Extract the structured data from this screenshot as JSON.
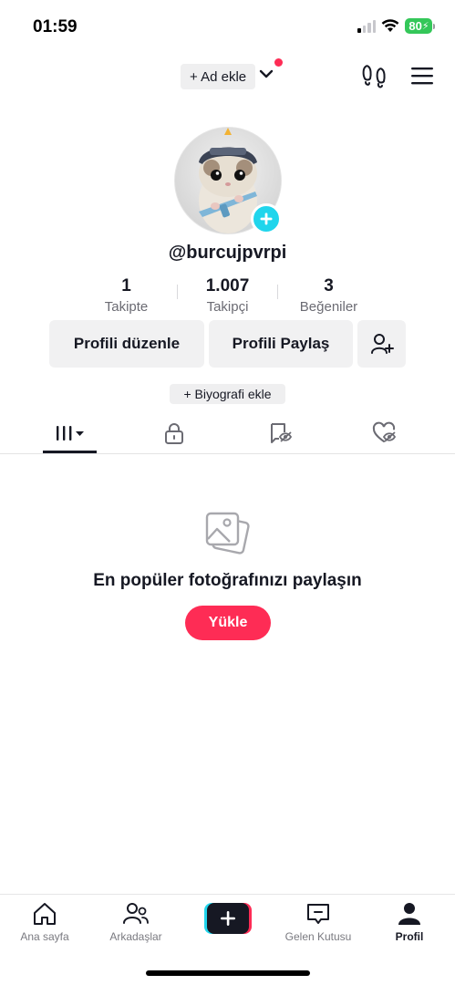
{
  "status_bar": {
    "time": "01:59",
    "battery": "80"
  },
  "top_bar": {
    "add_name_label": "+ Ad ekle"
  },
  "profile": {
    "username": "@burcujpvrpi",
    "stats": [
      {
        "value": "1",
        "label": "Takipte"
      },
      {
        "value": "1.007",
        "label": "Takipçi"
      },
      {
        "value": "3",
        "label": "Beğeniler"
      }
    ],
    "edit_button": "Profili düzenle",
    "share_button": "Profili Paylaş",
    "bio_button": "+ Biyografi ekle"
  },
  "tabs": [
    "videos-grid-icon",
    "lock-icon",
    "tagged-hidden-icon",
    "liked-hidden-icon"
  ],
  "empty_state": {
    "title": "En popüler fotoğrafınızı paylaşın",
    "button": "Yükle"
  },
  "bottom_nav": {
    "items": [
      {
        "label": "Ana sayfa"
      },
      {
        "label": "Arkadaşlar"
      },
      {
        "label": "Gelen Kutusu"
      },
      {
        "label": "Profil"
      }
    ]
  },
  "colors": {
    "accent": "#fe2c55",
    "avatar_badge": "#20d5ec",
    "text": "#161823",
    "battery": "#34c759"
  }
}
